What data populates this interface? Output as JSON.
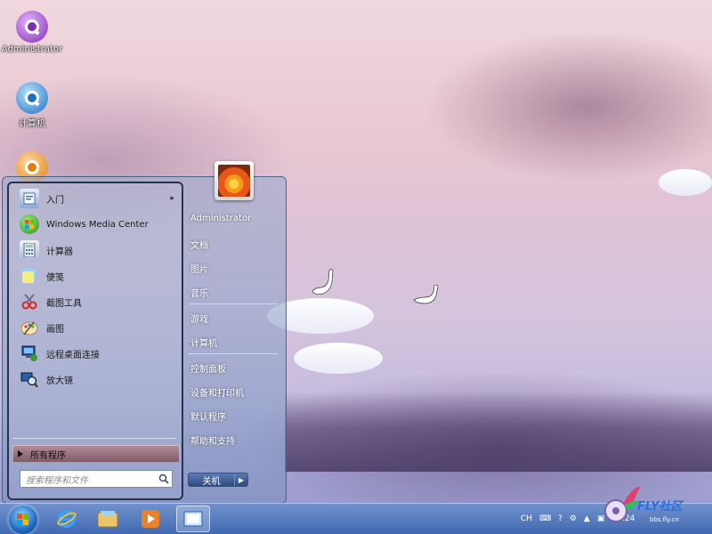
{
  "desktop": {
    "icons": [
      {
        "label": "Administrator"
      },
      {
        "label": "计算机"
      },
      {
        "label": ""
      }
    ]
  },
  "start_menu": {
    "pinned": [
      {
        "label": "入门",
        "icon": "getting-started-icon",
        "has_arrow": true
      },
      {
        "label": "Windows Media Center",
        "icon": "media-center-icon"
      },
      {
        "label": "计算器",
        "icon": "calculator-icon"
      },
      {
        "label": "便笺",
        "icon": "sticky-notes-icon"
      },
      {
        "label": "截图工具",
        "icon": "snipping-tool-icon"
      },
      {
        "label": "画图",
        "icon": "paint-icon"
      },
      {
        "label": "远程桌面连接",
        "icon": "remote-desktop-icon"
      },
      {
        "label": "放大镜",
        "icon": "magnifier-icon"
      }
    ],
    "all_programs": "所有程序",
    "search_placeholder": "搜索程序和文件",
    "right": [
      {
        "label": "Administrator"
      },
      {
        "label": "文档"
      },
      {
        "label": "图片"
      },
      {
        "label": "音乐"
      },
      {
        "label": "游戏"
      },
      {
        "label": "计算机"
      },
      {
        "label": "控制面板"
      },
      {
        "label": "设备和打印机"
      },
      {
        "label": "默认程序"
      },
      {
        "label": "帮助和支持"
      }
    ],
    "shutdown_label": "关机"
  },
  "taskbar": {
    "buttons": [
      {
        "name": "internet-explorer-icon"
      },
      {
        "name": "windows-explorer-icon"
      },
      {
        "name": "media-player-icon"
      },
      {
        "name": "active-window-icon"
      }
    ],
    "tray": {
      "language": "CH",
      "time": "20:24"
    }
  },
  "watermark": {
    "brand": "FLY社区",
    "sub": "bbs.fly.cn"
  }
}
